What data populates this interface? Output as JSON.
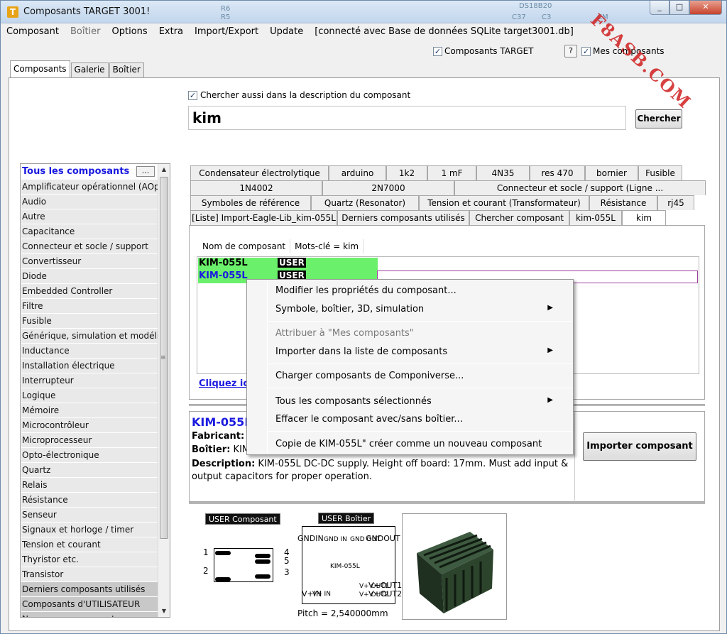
{
  "window": {
    "title": "Composants TARGET 3001!",
    "controls": {
      "minimize": "_",
      "maximize": "□",
      "close": "✕"
    },
    "bg_labels": [
      "R6",
      "R5",
      "C37",
      "C3",
      "DS18B20",
      "CM"
    ]
  },
  "menu": [
    {
      "label": "Composant",
      "disabled": false
    },
    {
      "label": "Boîtier",
      "disabled": true
    },
    {
      "label": "Options",
      "disabled": false
    },
    {
      "label": "Extra",
      "disabled": false
    },
    {
      "label": "Import/Export",
      "disabled": false
    },
    {
      "label": "Update",
      "disabled": false
    },
    {
      "label": "[connecté avec Base de données SQLite target3001.db]",
      "disabled": false
    }
  ],
  "top_options": {
    "target_components": "Composants TARGET",
    "help": "?",
    "my_components": "Mes composants"
  },
  "main_tabs": [
    "Composants",
    "Galerie",
    "Boîtier"
  ],
  "search": {
    "description_checkbox": "Chercher aussi dans la description du composant",
    "value": "kim",
    "button": "Chercher"
  },
  "categories": {
    "first": "Tous les composants",
    "dots": "...",
    "items": [
      "Amplificateur opérationnel (AOp)",
      "Audio",
      "Autre",
      "Capacitance",
      "Connecteur et socle / support",
      "Convertisseur",
      "Diode",
      "Embedded Controller",
      "Filtre",
      "Fusible",
      "Générique, simulation et modélisation",
      "Inductance",
      "Installation électrique",
      "Interrupteur",
      "Logique",
      "Mémoire",
      "Microcontrôleur",
      "Microprocesseur",
      "Opto-électronique",
      "Quartz",
      "Relais",
      "Résistance",
      "Senseur",
      "Signaux et horloge / timer",
      "Tension et courant",
      "Thyristor etc.",
      "Transistor"
    ],
    "grey_items": [
      "Derniers composants utilisés",
      "Composants d'UTILISATEUR",
      "Nouveaux composants"
    ]
  },
  "result_tabs": {
    "row1": [
      "Condensateur électrolytique",
      "arduino",
      "1k2",
      "1 mF",
      "4N35",
      "res 470",
      "bornier",
      "Fusible"
    ],
    "row2": [
      "1N4002",
      "2N7000",
      "Connecteur et socle / support (Ligne ..."
    ],
    "row3": [
      "Symboles de référence",
      "Quartz (Resonator)",
      "Tension et courant (Transformateur)",
      "Résistance",
      "rj45"
    ],
    "row4": [
      "[Liste] Import-Eagle-Lib_kim-055L",
      "Derniers composants utilisés",
      "Chercher composant",
      "kim-055L",
      "kim"
    ]
  },
  "results": {
    "col_name": "Nom de composant",
    "col_keywords": "Mots-clé =  kim",
    "rows": [
      {
        "name": "KIM-055L",
        "badge": "USER"
      },
      {
        "name": "KIM-055L",
        "badge": "USER"
      }
    ],
    "link": "Cliquez ici"
  },
  "detail": {
    "title": "KIM-055L",
    "manufacturer_label": "Fabricant:",
    "package_label": "Boîtier:",
    "package_value": "KIM-055L",
    "description_label": "Description:",
    "description_text": "KIM-055L DC-DC supply. Height off board: 17mm. Must add input & output capacitors for proper operation.",
    "import_button": "Importer composant"
  },
  "preview": {
    "symbol_label": "USER Composant",
    "package_label": "USER Boîtier",
    "pin_numbers": [
      "1",
      "2",
      "3",
      "4",
      "5"
    ],
    "pkg_name": "KIM-055L",
    "pins": [
      "GNDIN",
      "GNDOUT",
      "V+IN",
      "V+OUT1",
      "V+OUT2",
      "GND IN",
      "GND OUT",
      "V+ IN",
      "V+ OUT1",
      "V+ OUT2"
    ],
    "pitch": "Pitch = 2,540000mm"
  },
  "context_menu": [
    {
      "label": "Modifier les propriétés du composant...",
      "disabled": false,
      "submenu": false
    },
    {
      "label": "Symbole, boîtier, 3D, simulation",
      "disabled": false,
      "submenu": true
    },
    {
      "label": "Attribuer à \"Mes composants\"",
      "disabled": true,
      "submenu": false
    },
    {
      "label": "Importer dans la liste de composants",
      "disabled": false,
      "submenu": true
    },
    {
      "label": "Charger composants de Componiverse...",
      "disabled": false,
      "submenu": false
    },
    {
      "label": "Tous les composants sélectionnés",
      "disabled": false,
      "submenu": true
    },
    {
      "label": "Effacer le composant avec/sans boîtier...",
      "disabled": false,
      "submenu": false
    },
    {
      "label": "Copie de KIM-055L\" créer comme un nouveau composant",
      "disabled": false,
      "submenu": false
    }
  ],
  "watermark": "F8ASB.COM",
  "colors": {
    "accent_blue": "#1a1ae0",
    "row_green": "#6bf06b",
    "watermark_red": "#d02020"
  }
}
